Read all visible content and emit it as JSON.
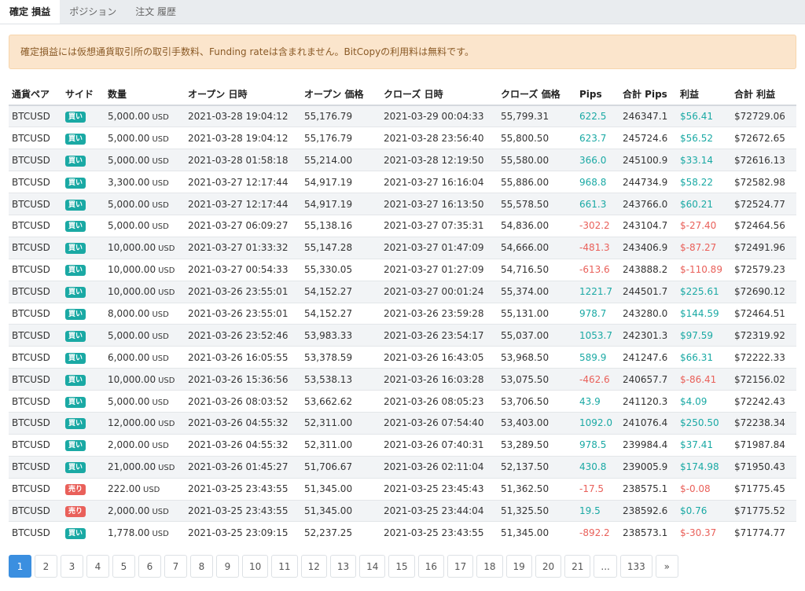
{
  "tabs": [
    {
      "label": "確定 損益",
      "active": true
    },
    {
      "label": "ポジション",
      "active": false
    },
    {
      "label": "注文 履歴",
      "active": false
    }
  ],
  "notice": "確定損益には仮想通貨取引所の取引手数料、Funding rateは含まれません。BitCopyの利用料は無料です。",
  "table": {
    "headers": [
      "通貨ペア",
      "サイド",
      "数量",
      "オープン 日時",
      "オープン 価格",
      "クローズ 日時",
      "クローズ 価格",
      "Pips",
      "合計 Pips",
      "利益",
      "合計 利益"
    ],
    "unit": "USD",
    "rows": [
      {
        "pair": "BTCUSD",
        "side": "買い",
        "qty": "5,000.00",
        "open_time": "2021-03-28 19:04:12",
        "open_price": "55,176.79",
        "close_time": "2021-03-29 00:04:33",
        "close_price": "55,799.31",
        "pips": "622.5",
        "total_pips": "246347.1",
        "profit": "$56.41",
        "total_profit": "$72729.06"
      },
      {
        "pair": "BTCUSD",
        "side": "買い",
        "qty": "5,000.00",
        "open_time": "2021-03-28 19:04:12",
        "open_price": "55,176.79",
        "close_time": "2021-03-28 23:56:40",
        "close_price": "55,800.50",
        "pips": "623.7",
        "total_pips": "245724.6",
        "profit": "$56.52",
        "total_profit": "$72672.65"
      },
      {
        "pair": "BTCUSD",
        "side": "買い",
        "qty": "5,000.00",
        "open_time": "2021-03-28 01:58:18",
        "open_price": "55,214.00",
        "close_time": "2021-03-28 12:19:50",
        "close_price": "55,580.00",
        "pips": "366.0",
        "total_pips": "245100.9",
        "profit": "$33.14",
        "total_profit": "$72616.13"
      },
      {
        "pair": "BTCUSD",
        "side": "買い",
        "qty": "3,300.00",
        "open_time": "2021-03-27 12:17:44",
        "open_price": "54,917.19",
        "close_time": "2021-03-27 16:16:04",
        "close_price": "55,886.00",
        "pips": "968.8",
        "total_pips": "244734.9",
        "profit": "$58.22",
        "total_profit": "$72582.98"
      },
      {
        "pair": "BTCUSD",
        "side": "買い",
        "qty": "5,000.00",
        "open_time": "2021-03-27 12:17:44",
        "open_price": "54,917.19",
        "close_time": "2021-03-27 16:13:50",
        "close_price": "55,578.50",
        "pips": "661.3",
        "total_pips": "243766.0",
        "profit": "$60.21",
        "total_profit": "$72524.77"
      },
      {
        "pair": "BTCUSD",
        "side": "買い",
        "qty": "5,000.00",
        "open_time": "2021-03-27 06:09:27",
        "open_price": "55,138.16",
        "close_time": "2021-03-27 07:35:31",
        "close_price": "54,836.00",
        "pips": "-302.2",
        "total_pips": "243104.7",
        "profit": "$-27.40",
        "total_profit": "$72464.56"
      },
      {
        "pair": "BTCUSD",
        "side": "買い",
        "qty": "10,000.00",
        "open_time": "2021-03-27 01:33:32",
        "open_price": "55,147.28",
        "close_time": "2021-03-27 01:47:09",
        "close_price": "54,666.00",
        "pips": "-481.3",
        "total_pips": "243406.9",
        "profit": "$-87.27",
        "total_profit": "$72491.96"
      },
      {
        "pair": "BTCUSD",
        "side": "買い",
        "qty": "10,000.00",
        "open_time": "2021-03-27 00:54:33",
        "open_price": "55,330.05",
        "close_time": "2021-03-27 01:27:09",
        "close_price": "54,716.50",
        "pips": "-613.6",
        "total_pips": "243888.2",
        "profit": "$-110.89",
        "total_profit": "$72579.23"
      },
      {
        "pair": "BTCUSD",
        "side": "買い",
        "qty": "10,000.00",
        "open_time": "2021-03-26 23:55:01",
        "open_price": "54,152.27",
        "close_time": "2021-03-27 00:01:24",
        "close_price": "55,374.00",
        "pips": "1221.7",
        "total_pips": "244501.7",
        "profit": "$225.61",
        "total_profit": "$72690.12"
      },
      {
        "pair": "BTCUSD",
        "side": "買い",
        "qty": "8,000.00",
        "open_time": "2021-03-26 23:55:01",
        "open_price": "54,152.27",
        "close_time": "2021-03-26 23:59:28",
        "close_price": "55,131.00",
        "pips": "978.7",
        "total_pips": "243280.0",
        "profit": "$144.59",
        "total_profit": "$72464.51"
      },
      {
        "pair": "BTCUSD",
        "side": "買い",
        "qty": "5,000.00",
        "open_time": "2021-03-26 23:52:46",
        "open_price": "53,983.33",
        "close_time": "2021-03-26 23:54:17",
        "close_price": "55,037.00",
        "pips": "1053.7",
        "total_pips": "242301.3",
        "profit": "$97.59",
        "total_profit": "$72319.92"
      },
      {
        "pair": "BTCUSD",
        "side": "買い",
        "qty": "6,000.00",
        "open_time": "2021-03-26 16:05:55",
        "open_price": "53,378.59",
        "close_time": "2021-03-26 16:43:05",
        "close_price": "53,968.50",
        "pips": "589.9",
        "total_pips": "241247.6",
        "profit": "$66.31",
        "total_profit": "$72222.33"
      },
      {
        "pair": "BTCUSD",
        "side": "買い",
        "qty": "10,000.00",
        "open_time": "2021-03-26 15:36:56",
        "open_price": "53,538.13",
        "close_time": "2021-03-26 16:03:28",
        "close_price": "53,075.50",
        "pips": "-462.6",
        "total_pips": "240657.7",
        "profit": "$-86.41",
        "total_profit": "$72156.02"
      },
      {
        "pair": "BTCUSD",
        "side": "買い",
        "qty": "5,000.00",
        "open_time": "2021-03-26 08:03:52",
        "open_price": "53,662.62",
        "close_time": "2021-03-26 08:05:23",
        "close_price": "53,706.50",
        "pips": "43.9",
        "total_pips": "241120.3",
        "profit": "$4.09",
        "total_profit": "$72242.43"
      },
      {
        "pair": "BTCUSD",
        "side": "買い",
        "qty": "12,000.00",
        "open_time": "2021-03-26 04:55:32",
        "open_price": "52,311.00",
        "close_time": "2021-03-26 07:54:40",
        "close_price": "53,403.00",
        "pips": "1092.0",
        "total_pips": "241076.4",
        "profit": "$250.50",
        "total_profit": "$72238.34"
      },
      {
        "pair": "BTCUSD",
        "side": "買い",
        "qty": "2,000.00",
        "open_time": "2021-03-26 04:55:32",
        "open_price": "52,311.00",
        "close_time": "2021-03-26 07:40:31",
        "close_price": "53,289.50",
        "pips": "978.5",
        "total_pips": "239984.4",
        "profit": "$37.41",
        "total_profit": "$71987.84"
      },
      {
        "pair": "BTCUSD",
        "side": "買い",
        "qty": "21,000.00",
        "open_time": "2021-03-26 01:45:27",
        "open_price": "51,706.67",
        "close_time": "2021-03-26 02:11:04",
        "close_price": "52,137.50",
        "pips": "430.8",
        "total_pips": "239005.9",
        "profit": "$174.98",
        "total_profit": "$71950.43"
      },
      {
        "pair": "BTCUSD",
        "side": "売り",
        "qty": "222.00",
        "open_time": "2021-03-25 23:43:55",
        "open_price": "51,345.00",
        "close_time": "2021-03-25 23:45:43",
        "close_price": "51,362.50",
        "pips": "-17.5",
        "total_pips": "238575.1",
        "profit": "$-0.08",
        "total_profit": "$71775.45"
      },
      {
        "pair": "BTCUSD",
        "side": "売り",
        "qty": "2,000.00",
        "open_time": "2021-03-25 23:43:55",
        "open_price": "51,345.00",
        "close_time": "2021-03-25 23:44:04",
        "close_price": "51,325.50",
        "pips": "19.5",
        "total_pips": "238592.6",
        "profit": "$0.76",
        "total_profit": "$71775.52"
      },
      {
        "pair": "BTCUSD",
        "side": "買い",
        "qty": "1,778.00",
        "open_time": "2021-03-25 23:09:15",
        "open_price": "52,237.25",
        "close_time": "2021-03-25 23:43:55",
        "close_price": "51,345.00",
        "pips": "-892.2",
        "total_pips": "238573.1",
        "profit": "$-30.37",
        "total_profit": "$71774.77"
      }
    ]
  },
  "pagination": {
    "pages": [
      "1",
      "2",
      "3",
      "4",
      "5",
      "6",
      "7",
      "8",
      "9",
      "10",
      "11",
      "12",
      "13",
      "14",
      "15",
      "16",
      "17",
      "18",
      "19",
      "20",
      "21",
      "...",
      "133",
      "»"
    ],
    "current": "1"
  },
  "colors": {
    "buy": "#1aa9a4",
    "sell": "#e9605a",
    "positive": "#1aa9a4",
    "negative": "#e9605a",
    "active_page": "#3b8fe0"
  }
}
